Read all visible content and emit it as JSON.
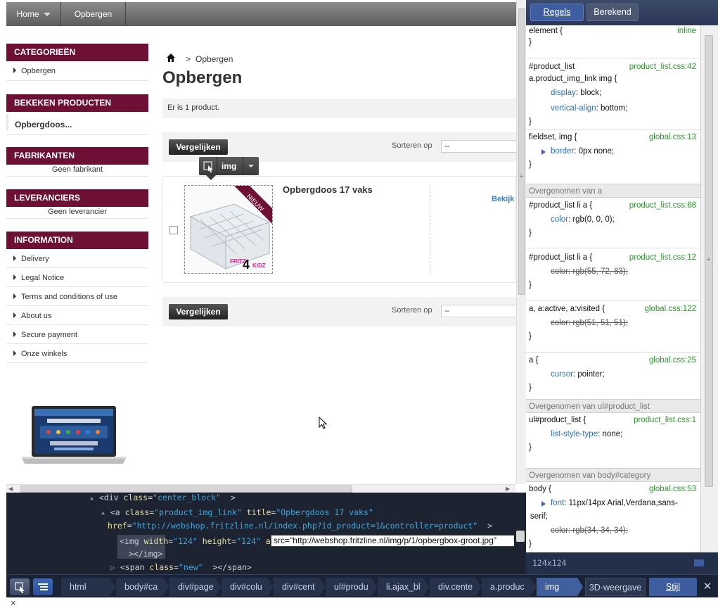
{
  "nav": {
    "home": "Home",
    "opbergen": "Opbergen"
  },
  "sidebar": {
    "categories_title": "CATEGORIEËN",
    "categories": [
      "Opbergen"
    ],
    "viewed_title": "BEKEKEN PRODUCTEN",
    "viewed_item": "Opbergdoos...",
    "manufacturers_title": "FABRIKANTEN",
    "manufacturers_empty": "Geen fabrikant",
    "suppliers_title": "LEVERANCIERS",
    "suppliers_empty": "Geen leverancier",
    "information_title": "INFORMATION",
    "information_items": [
      "Delivery",
      "Legal Notice",
      "Terms and conditions of use",
      "About us",
      "Secure payment",
      "Onze winkels"
    ]
  },
  "main": {
    "breadcrumb_sep": ">",
    "breadcrumb": "Opbergen",
    "title": "Opbergen",
    "count": "Er is 1 product.",
    "compare_label": "Vergelijken",
    "sort_label": "Sorteren op",
    "sort_value": "--",
    "product_name": "Opbergdoos 17 vaks",
    "product_badge": "NIEUW",
    "product_logo_a": "FRITZ",
    "product_logo_b": "4",
    "product_logo_c": "KIDZ",
    "view_link": "Bekijk"
  },
  "inspector_tip": {
    "label": "img"
  },
  "html_panel": {
    "line1": {
      "tag_open": "<div ",
      "attr": "class",
      "val": "\"center_block\"",
      "tag_close": ">"
    },
    "line2": {
      "tag_open": "<a ",
      "attr1": "class",
      "val1": "\"product_img_link\"",
      "attr2": "title",
      "val2": "\"Opbergdoos 17 vaks\""
    },
    "line3": {
      "attr": "href",
      "val": "\"http://webshop.fritzline.nl/index.php?id_product=1&controller=product\"",
      "tag_close": ">"
    },
    "line4": {
      "tag_open": "<img ",
      "attr1": "width",
      "val1": "\"124\"",
      "attr2": "height",
      "val2": "\"124\"",
      "attr3": "alt",
      "val3": "\"\""
    },
    "edit_value": "src=\"http://webshop.fritzline.nl/img/p/1/opbergbox-groot.jpg\"",
    "line5": "></img>",
    "line6": {
      "tag_open": "<span ",
      "attr": "class",
      "val": "\"new\"",
      "tag_close": "></span>"
    }
  },
  "css_panel": {
    "tab_rules": "Regels",
    "tab_computed": "Berekend",
    "rule1": {
      "selector": "element {",
      "source": "inline",
      "close": "}"
    },
    "rule2": {
      "selector1": "#product_list",
      "selector2": "a.product_img_link img {",
      "source": "product_list.css:42",
      "p1_name": "display",
      "p1_val": " block;",
      "p2_name": "vertical-align",
      "p2_val": " bottom;",
      "close": "}"
    },
    "rule3": {
      "selector": "fieldset, img {",
      "source": "global.css:13",
      "p1_name": "border",
      "p1_val": " 0px none;",
      "close": "}"
    },
    "inherited_a": "Overgenomen van a",
    "rule4": {
      "selector": "#product_list li a {",
      "source": "product_list.css:68",
      "p1_name": "color",
      "p1_val": " rgb(0, 0, 0);",
      "close": "}"
    },
    "rule5": {
      "selector": "#product_list li a {",
      "source": "product_list.css:12",
      "p1": "color: rgb(55, 72, 83);",
      "close": "}"
    },
    "rule6": {
      "selector": "a, a:active, a:visited {",
      "source": "global.css:122",
      "p1": "color: rgb(51, 51, 51);",
      "close": "}"
    },
    "rule7": {
      "selector": "a {",
      "source": "global.css:25",
      "p1_name": "cursor",
      "p1_val": " pointer;",
      "close": "}"
    },
    "inherited_ul": "Overgenomen van ul#product_list",
    "rule8": {
      "selector": "ul#product_list {",
      "source": "product_list.css:1",
      "p1_name": "list-style-type",
      "p1_val": " none;",
      "close": "}"
    },
    "inherited_body": "Overgenomen van body#category",
    "rule9": {
      "selector": "body {",
      "source": "global.css:53",
      "p1_name": "font",
      "p1_val": " 11px/14px Arial,Verdana,sans-",
      "p1_cont": "serif;",
      "p2": "color: rgb(34, 34, 34);",
      "close": "}"
    },
    "status": "124x124"
  },
  "toolbar": {
    "crumbs": [
      "html",
      "body#ca",
      "div#page",
      "div#colu",
      "div#cent",
      "ul#produ",
      "li.ajax_bl",
      "div.cente",
      "a.produc",
      "img"
    ],
    "view_3d": "3D-weergave",
    "style": "Stijl",
    "close": "✕"
  },
  "bottom_close": "×",
  "colors": {
    "sidebar_header": "#6e0f35",
    "link_blue": "#3a7fc1",
    "devtools_bg": "#1d2330",
    "css_source_green": "#2b9a2b"
  }
}
